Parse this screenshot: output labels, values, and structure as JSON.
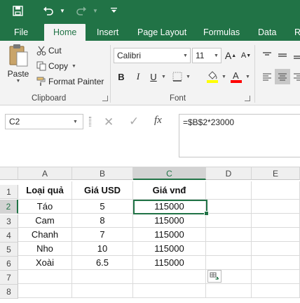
{
  "quick_access": {
    "save_icon": "save-icon",
    "undo_icon": "undo-icon",
    "redo_icon": "redo-icon"
  },
  "tabs": [
    "File",
    "Home",
    "Insert",
    "Page Layout",
    "Formulas",
    "Data",
    "R"
  ],
  "active_tab": "Home",
  "clipboard": {
    "paste": "Paste",
    "cut": "Cut",
    "copy": "Copy",
    "format_painter": "Format Painter",
    "label": "Clipboard"
  },
  "font": {
    "name": "Calibri",
    "size": "11",
    "bold": "B",
    "italic": "I",
    "underline": "U",
    "label": "Font",
    "grow": "A",
    "shrink": "A",
    "fill_color": "#ffff00",
    "font_color": "#ff0000"
  },
  "formula_bar": {
    "name_box": "C2",
    "fx": "fx",
    "formula": "=$B$2*23000"
  },
  "columns": [
    "A",
    "B",
    "C",
    "D",
    "E"
  ],
  "rows": [
    "1",
    "2",
    "3",
    "4",
    "5",
    "6",
    "7",
    "8"
  ],
  "table": {
    "headers": [
      "Loại quả",
      "Giá USD",
      "Giá vnđ"
    ],
    "data": [
      [
        "Táo",
        "5",
        "115000"
      ],
      [
        "Cam",
        "8",
        "115000"
      ],
      [
        "Chanh",
        "7",
        "115000"
      ],
      [
        "Nho",
        "10",
        "115000"
      ],
      [
        "Xoài",
        "6.5",
        "115000"
      ]
    ]
  },
  "selected_cell": "C2",
  "accent_color": "#217346"
}
